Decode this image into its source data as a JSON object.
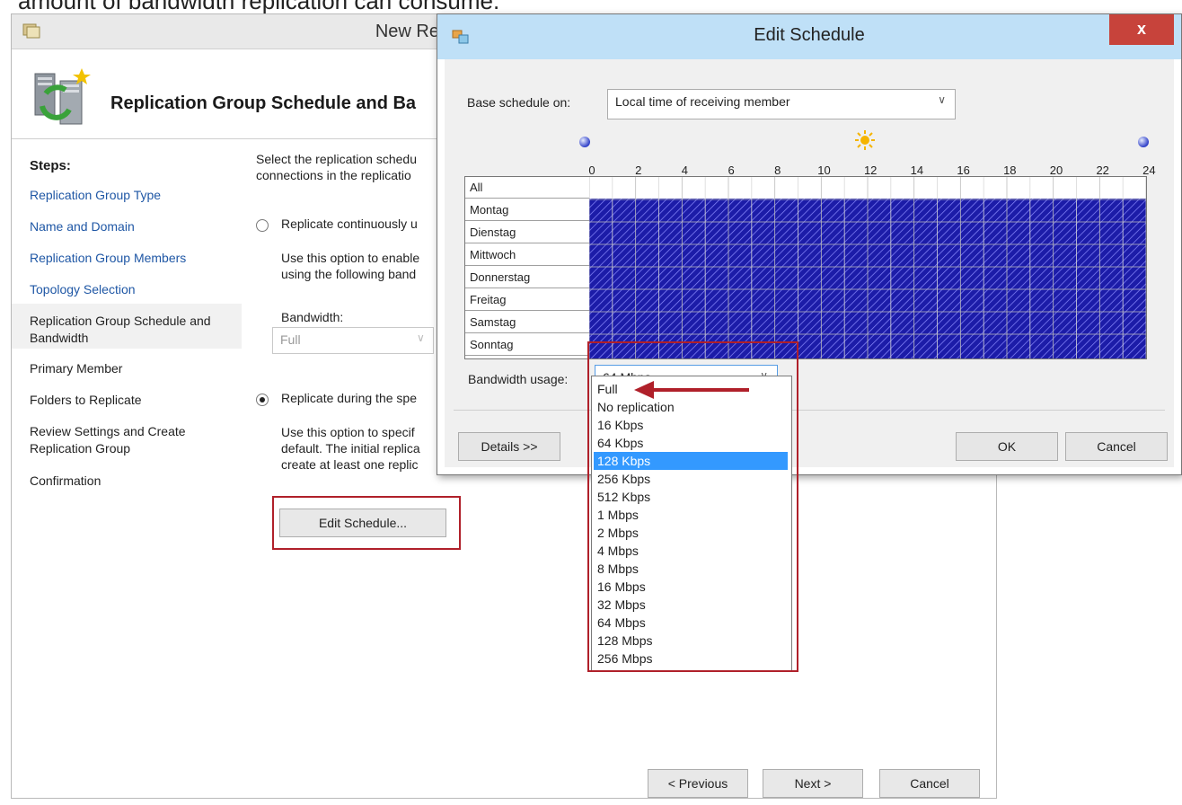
{
  "caption": "amount of bandwidth replication can consume.",
  "wizard": {
    "title": "New Re",
    "header_title": "Replication Group Schedule and Ba",
    "steps_heading": "Steps:",
    "steps": [
      "Replication Group Type",
      "Name and Domain",
      "Replication Group Members",
      "Topology Selection",
      "Replication Group Schedule and Bandwidth",
      "Primary Member",
      "Folders to Replicate",
      "Review Settings and Create Replication Group",
      "Confirmation"
    ],
    "current_step": 4,
    "intro_line1": "Select the replication schedu",
    "intro_line2": "connections in the replicatio",
    "opt1_label": "Replicate continuously u",
    "opt1_desc1": "Use this option to enable",
    "opt1_desc2": "using the following band",
    "bandwidth_label": "Bandwidth:",
    "bandwidth_value": "Full",
    "opt2_label": "Replicate during the spe",
    "opt2_desc1": "Use this option to specif",
    "opt2_desc2": "default. The initial replica",
    "opt2_desc3": "create at least one replic",
    "edit_schedule_button": "Edit Schedule...",
    "previous_button": "< Previous",
    "next_button": "Next >",
    "cancel_button": "Cancel"
  },
  "dialog": {
    "title": "Edit Schedule",
    "close_label": "x",
    "base_label": "Base schedule on:",
    "base_value": "Local time of receiving member",
    "hours": [
      "0",
      "2",
      "4",
      "6",
      "8",
      "10",
      "12",
      "14",
      "16",
      "18",
      "20",
      "22",
      "24"
    ],
    "days": [
      "All",
      "Montag",
      "Dienstag",
      "Mittwoch",
      "Donnerstag",
      "Freitag",
      "Samstag",
      "Sonntag"
    ],
    "bandwidth_label": "Bandwidth usage:",
    "bandwidth_value": "64 Mbps",
    "details_button": "Details >>",
    "ok_button": "OK",
    "cancel_button": "Cancel",
    "dropdown_options": [
      "Full",
      "No replication",
      "16 Kbps",
      "64 Kbps",
      "128 Kbps",
      "256 Kbps",
      "512 Kbps",
      "1 Mbps",
      "2 Mbps",
      "4 Mbps",
      "8 Mbps",
      "16 Mbps",
      "32 Mbps",
      "64 Mbps",
      "128 Mbps",
      "256 Mbps"
    ],
    "highlighted_option": 4
  },
  "colors": {
    "schedule_fill": "#1c1ca8",
    "title_bar": "#bfe0f7",
    "highlight": "#b0202a",
    "link": "#1f57a5"
  }
}
